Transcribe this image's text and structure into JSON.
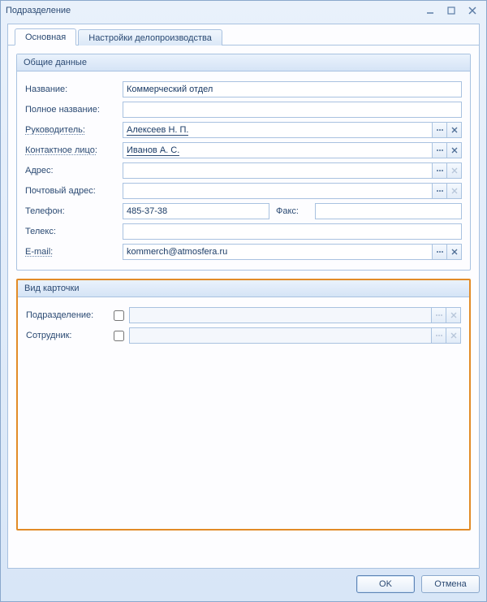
{
  "window": {
    "title": "Подразделение"
  },
  "tabs": {
    "main": "Основная",
    "settings": "Настройки делопроизводства"
  },
  "group_general": {
    "title": "Общие данные",
    "labels": {
      "name": "Название:",
      "fullname": "Полное название:",
      "head": "Руководитель:",
      "contact": "Контактное лицо:",
      "address": "Адрес:",
      "post_address": "Почтовый адрес:",
      "phone": "Телефон:",
      "fax": "Факс:",
      "telex": "Телекс:",
      "email": "E-mail:"
    },
    "values": {
      "name": "Коммерческий отдел",
      "fullname": "",
      "head": "Алексеев Н. П.",
      "contact": "Иванов А. С.",
      "address": "",
      "post_address": "",
      "phone": "485-37-38",
      "fax": "",
      "telex": "",
      "email": "kommerch@atmosfera.ru"
    }
  },
  "group_cardtype": {
    "title": "Вид карточки",
    "labels": {
      "department": "Подразделение:",
      "employee": "Сотрудник:"
    },
    "values": {
      "department": "",
      "employee": ""
    }
  },
  "footer": {
    "ok": "OK",
    "cancel": "Отмена"
  }
}
